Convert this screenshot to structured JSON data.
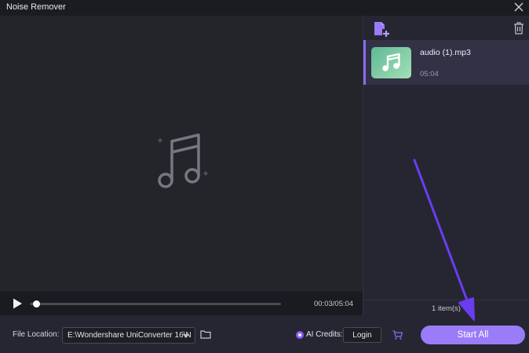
{
  "window": {
    "title": "Noise Remover"
  },
  "player": {
    "time": "00:03/05:04",
    "progress": 0.01
  },
  "file_list": {
    "items": [
      {
        "name": "audio (1).mp3",
        "duration": "05:04",
        "selected": true
      }
    ],
    "count_text": "1 item(s)"
  },
  "bottom_bar": {
    "location_label": "File Location:",
    "location_value": "E:\\Wondershare UniConverter 16\\N",
    "credits_label": "AI Credits:",
    "login_label": "Login",
    "start_label": "Start All"
  },
  "icons": {
    "close": "close-icon",
    "music_placeholder": "music-note-icon",
    "play": "play-icon",
    "add_file": "add-file-icon",
    "trash": "trash-icon",
    "folder": "folder-icon",
    "credits": "ai-credits-icon",
    "cart": "cart-icon"
  },
  "colors": {
    "accent": "#9b7cf8",
    "selection_bar": "#8a6cf5",
    "annotation_arrow": "#6b3df0"
  }
}
